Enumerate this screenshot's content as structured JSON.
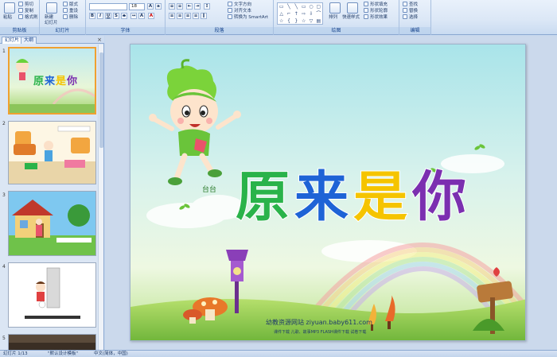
{
  "ribbon": {
    "groups": [
      {
        "label": "剪贴板"
      },
      {
        "label": "幻灯片"
      },
      {
        "label": "字体"
      },
      {
        "label": "段落"
      },
      {
        "label": "绘图"
      },
      {
        "label": "编辑"
      }
    ],
    "clipboard": {
      "paste": "粘贴",
      "cut": "剪切",
      "copy": "复制",
      "format_painter": "格式刷"
    },
    "slides": {
      "new_slide": "新建",
      "new_slide_line2": "幻灯片",
      "layout": "版式",
      "reset": "重设",
      "delete": "删除"
    },
    "font": {
      "font_size": "18"
    },
    "paragraph": {
      "text_direction": "文字方向",
      "align_text": "对齐文本",
      "smartart": "转换为 SmartArt"
    },
    "drawing": {
      "arrange": "排列",
      "quick_styles": "快速样式",
      "shape_fill": "形状填充",
      "shape_outline": "形状轮廓",
      "shape_effects": "形状效果"
    },
    "editing": {
      "find": "查找",
      "replace": "替换",
      "select": "选择"
    }
  },
  "left_panel": {
    "tabs": [
      "幻灯片",
      "大纲"
    ],
    "close": "×",
    "slides": [
      {
        "num": "1",
        "title": "原来是你"
      },
      {
        "num": "2"
      },
      {
        "num": "3"
      },
      {
        "num": "4"
      },
      {
        "num": "5"
      }
    ]
  },
  "slide": {
    "title_chars": [
      "原",
      "来",
      "是",
      "你"
    ],
    "title_colors": [
      "#2ab34a",
      "#1e63d6",
      "#f5c400",
      "#7b2fb0"
    ],
    "character_name": "台台",
    "footer_site": "幼教资源网站  ziyuan.baby611.com",
    "footer_links": "课件下载  儿歌、故事MP3  FLASH课件下载  试卷下载"
  },
  "status": {
    "slide_info": "幻灯片 1/13",
    "theme": "\"默认设计模板\"",
    "language": "中文(简体，中国)"
  }
}
